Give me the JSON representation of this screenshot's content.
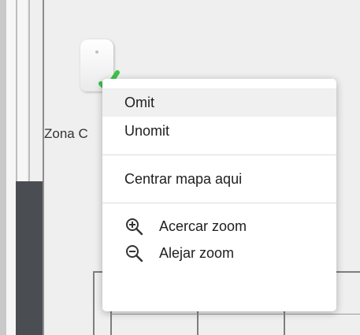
{
  "map": {
    "zone_label": "Zona C"
  },
  "context_menu": {
    "items": [
      {
        "label": "Omit"
      },
      {
        "label": "Unomit"
      }
    ],
    "center_label": "Centrar mapa aqui",
    "zoom_in_label": "Acercar zoom",
    "zoom_out_label": "Alejar zoom"
  },
  "colors": {
    "status_green": "#3cc24a",
    "menu_hover": "#f0f0f0",
    "sidebar_dark": "#4a4d52"
  },
  "icons": {
    "zoom_in": "zoom-in-icon",
    "zoom_out": "zoom-out-icon",
    "sensor": "motion-sensor-icon",
    "status": "check-icon"
  }
}
